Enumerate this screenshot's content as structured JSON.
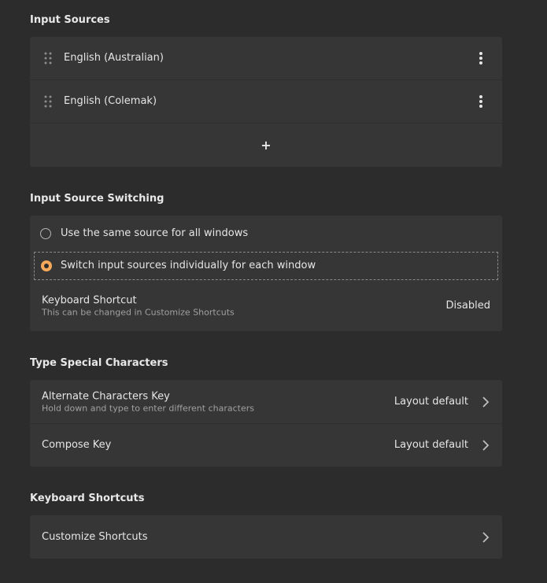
{
  "sections": {
    "input_sources": {
      "title": "Input Sources",
      "items": [
        {
          "label": "English (Australian)"
        },
        {
          "label": "English (Colemak)"
        }
      ],
      "add_label": "+"
    },
    "switching": {
      "title": "Input Source Switching",
      "options": [
        {
          "label": "Use the same source for all windows",
          "checked": false
        },
        {
          "label": "Switch input sources individually for each window",
          "checked": true
        }
      ],
      "shortcut": {
        "label": "Keyboard Shortcut",
        "subtitle": "This can be changed in Customize Shortcuts",
        "value": "Disabled"
      }
    },
    "special_chars": {
      "title": "Type Special Characters",
      "alternate": {
        "label": "Alternate Characters Key",
        "subtitle": "Hold down and type to enter different characters",
        "value": "Layout default"
      },
      "compose": {
        "label": "Compose Key",
        "value": "Layout default"
      }
    },
    "shortcuts": {
      "title": "Keyboard Shortcuts",
      "customize_label": "Customize Shortcuts"
    }
  },
  "colors": {
    "background": "#2c2c2c",
    "card": "#363636",
    "accent": "#f6a95b"
  }
}
